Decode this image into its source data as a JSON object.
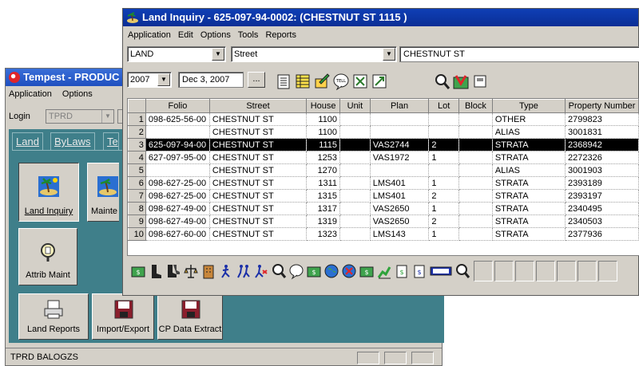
{
  "back_window": {
    "title": "Tempest - PRODUC",
    "menu": [
      "Application",
      "Options"
    ],
    "login_label": "Login",
    "login_value": "TPRD",
    "tabs": [
      "Land",
      "ByLaws",
      "Te"
    ],
    "tiles": [
      {
        "label": "Land Inquiry",
        "icon": "island-icon"
      },
      {
        "label": "Mainte",
        "icon": "island-icon"
      },
      {
        "label": "Attrib Maint",
        "icon": "magnifier-icon"
      },
      {
        "label": "Land Reports",
        "icon": "printer-icon"
      },
      {
        "label": "Import/Export",
        "icon": "floppy-disk-icon"
      },
      {
        "label": "CP Data Extract",
        "icon": "floppy-disk-icon"
      }
    ],
    "status_text": "TPRD BALOGZS"
  },
  "front_window": {
    "title": "Land Inquiry - 625-097-94-0002:  (CHESTNUT ST  1115  )",
    "menu": [
      "Application",
      "Edit",
      "Options",
      "Tools",
      "Reports"
    ],
    "type_combo": "LAND",
    "search_combo": "Street",
    "search_value": "CHESTNUT ST",
    "year_combo": "2007",
    "date_value": "Dec 3, 2007",
    "date_button": "...",
    "table": {
      "columns": [
        "Folio",
        "Street",
        "House",
        "Unit",
        "Plan",
        "Lot",
        "Block",
        "Type",
        "Property Number"
      ],
      "selected_row": 3,
      "rows": [
        {
          "n": "1",
          "folio": "098-625-56-00",
          "street": "CHESTNUT ST",
          "house": "1100",
          "unit": "",
          "plan": "",
          "lot": "",
          "block": "",
          "type": "OTHER",
          "prop": "2799823"
        },
        {
          "n": "2",
          "folio": "",
          "street": "CHESTNUT ST",
          "house": "1100",
          "unit": "",
          "plan": "",
          "lot": "",
          "block": "",
          "type": "ALIAS",
          "prop": "3001831"
        },
        {
          "n": "3",
          "folio": "625-097-94-00",
          "street": "CHESTNUT ST",
          "house": "1115",
          "unit": "",
          "plan": "VAS2744",
          "lot": "2",
          "block": "",
          "type": "STRATA",
          "prop": "2368942"
        },
        {
          "n": "4",
          "folio": "627-097-95-00",
          "street": "CHESTNUT ST",
          "house": "1253",
          "unit": "",
          "plan": "VAS1972",
          "lot": "1",
          "block": "",
          "type": "STRATA",
          "prop": "2272326"
        },
        {
          "n": "5",
          "folio": "",
          "street": "CHESTNUT ST",
          "house": "1270",
          "unit": "",
          "plan": "",
          "lot": "",
          "block": "",
          "type": "ALIAS",
          "prop": "3001903"
        },
        {
          "n": "6",
          "folio": "098-627-25-00",
          "street": "CHESTNUT ST",
          "house": "1311",
          "unit": "",
          "plan": "LMS401",
          "lot": "1",
          "block": "",
          "type": "STRATA",
          "prop": "2393189"
        },
        {
          "n": "7",
          "folio": "098-627-25-00",
          "street": "CHESTNUT ST",
          "house": "1315",
          "unit": "",
          "plan": "LMS401",
          "lot": "2",
          "block": "",
          "type": "STRATA",
          "prop": "2393197"
        },
        {
          "n": "8",
          "folio": "098-627-49-00",
          "street": "CHESTNUT ST",
          "house": "1317",
          "unit": "",
          "plan": "VAS2650",
          "lot": "1",
          "block": "",
          "type": "STRATA",
          "prop": "2340495"
        },
        {
          "n": "9",
          "folio": "098-627-49-00",
          "street": "CHESTNUT ST",
          "house": "1319",
          "unit": "",
          "plan": "VAS2650",
          "lot": "2",
          "block": "",
          "type": "STRATA",
          "prop": "2340503"
        },
        {
          "n": "10",
          "folio": "098-627-60-00",
          "street": "CHESTNUT ST",
          "house": "1323",
          "unit": "",
          "plan": "LMS143",
          "lot": "1",
          "block": "",
          "type": "STRATA",
          "prop": "2377936"
        }
      ]
    },
    "colors": {
      "selected_row_bg": "#000000",
      "title_bar": "#0a2e95",
      "teal": "#3f7f8a"
    }
  }
}
